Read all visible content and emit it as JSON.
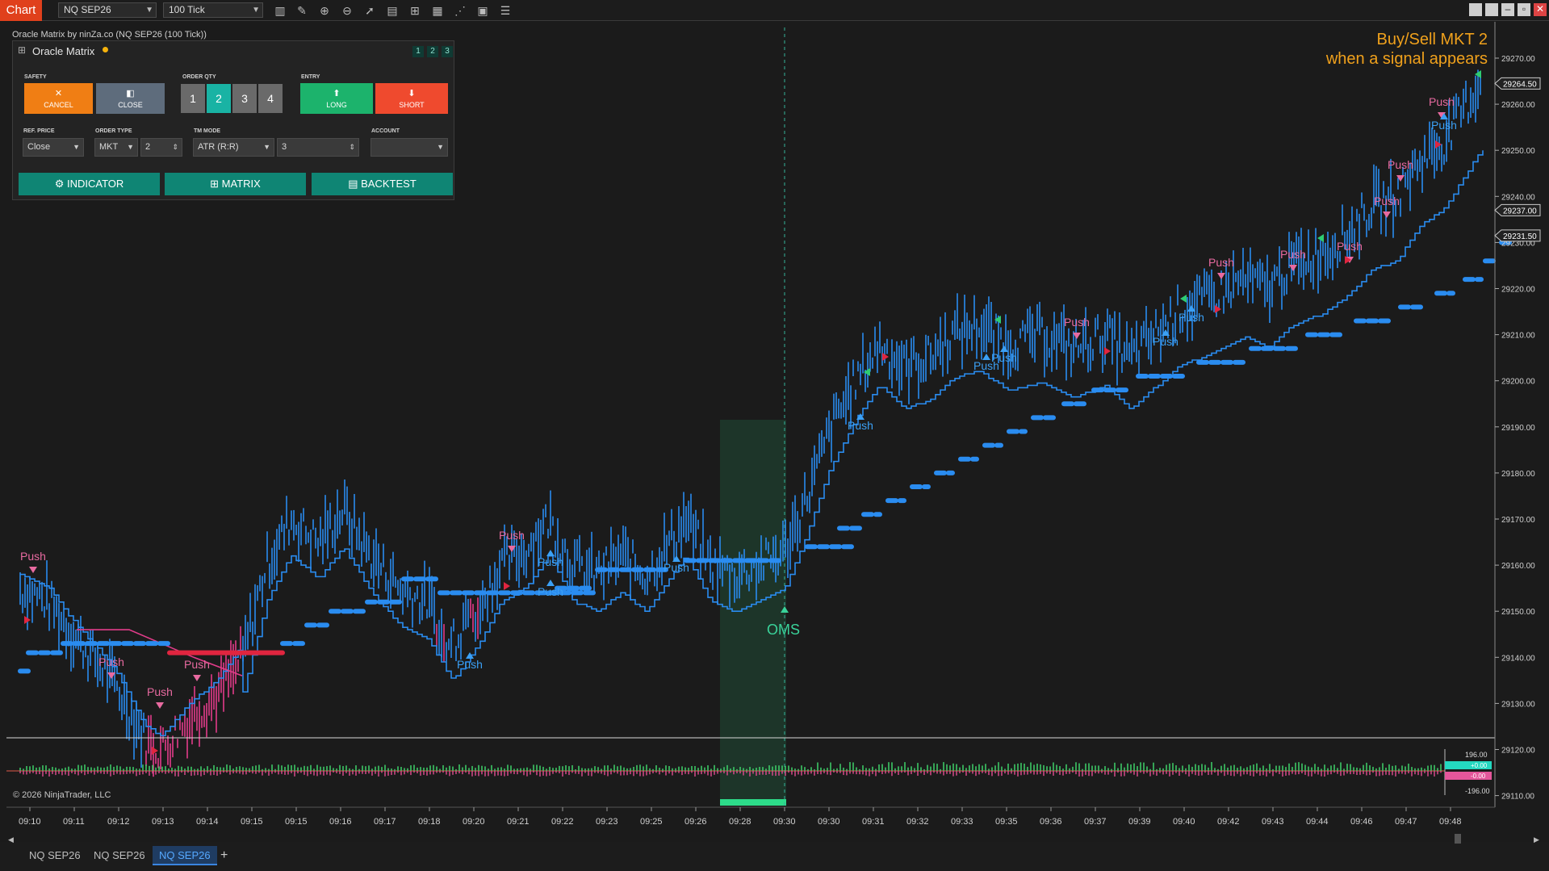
{
  "toolbar": {
    "chart_tab": "Chart",
    "instrument": "NQ SEP26",
    "interval": "100 Tick",
    "icons": [
      "bar-type-icon",
      "draw-pencil-icon",
      "zoom-in-icon",
      "zoom-out-icon",
      "pointer-icon",
      "data-box-icon",
      "chart-trader-icon",
      "templates-icon",
      "strategies-icon",
      "properties-icon",
      "object-list-icon"
    ],
    "window_buttons": [
      "restore-icon",
      "minimize-icon",
      "maximize-icon",
      "close-icon"
    ]
  },
  "indicator_label": "Oracle Matrix by ninZa.co (NQ SEP26 (100 Tick))",
  "panel": {
    "title": "Oracle Matrix",
    "pages": [
      "1",
      "2",
      "3"
    ],
    "sections": {
      "safety": "SAFETY",
      "order_qty": "ORDER QTY",
      "entry": "ENTRY",
      "ref_price": "REF. PRICE",
      "order_type": "ORDER TYPE",
      "tm_mode": "TM MODE",
      "account": "ACCOUNT"
    },
    "cancel": "CANCEL",
    "close": "CLOSE",
    "qty": [
      "1",
      "2",
      "3",
      "4"
    ],
    "qty_selected": "2",
    "long": "LONG",
    "short": "SHORT",
    "ref_price_value": "Close",
    "order_type_value": "MKT",
    "order_type_qty": "2",
    "tm_mode_value": "ATR (R:R)",
    "tm_mode_qty": "3",
    "account_value": "",
    "indicator_btn": "INDICATOR",
    "matrix_btn": "MATRIX",
    "backtest_btn": "BACKTEST"
  },
  "overlay_note": {
    "line1": "Buy/Sell MKT 2",
    "line2": "when a signal appears"
  },
  "price_axis": {
    "labels": [
      "29270.00",
      "29260.00",
      "29250.00",
      "29240.00",
      "29230.00",
      "29220.00",
      "29210.00",
      "29200.00",
      "29190.00",
      "29180.00",
      "29170.00",
      "29160.00",
      "29150.00",
      "29140.00",
      "29130.00",
      "29120.00",
      "29110.00"
    ],
    "tags": [
      "29264.50",
      "29237.00",
      "29231.50"
    ]
  },
  "time_axis": [
    "09:10",
    "09:11",
    "09:12",
    "09:13",
    "09:14",
    "09:15",
    "09:15",
    "09:16",
    "09:17",
    "09:18",
    "09:20",
    "09:21",
    "09:22",
    "09:23",
    "09:25",
    "09:26",
    "09:28",
    "09:30",
    "09:30",
    "09:31",
    "09:32",
    "09:33",
    "09:35",
    "09:36",
    "09:37",
    "09:39",
    "09:40",
    "09:42",
    "09:43",
    "09:44",
    "09:46",
    "09:47",
    "09:48"
  ],
  "signals": {
    "push": "Push",
    "oms": "OMS"
  },
  "sub_panel": {
    "upper": "196.00",
    "lower": "-196.00",
    "tag_up": "+0.00",
    "tag_down": "-0.00"
  },
  "copyright": "© 2026 NinjaTrader, LLC",
  "bottom_tabs": [
    "NQ SEP26",
    "NQ SEP26",
    "NQ SEP26"
  ],
  "active_tab_index": 2,
  "colors": {
    "accent": "#e0401c",
    "bull": "#2a8cf0",
    "bear": "#e23c8a",
    "teal": "#0f8574",
    "push_label": "#e86aa0",
    "push_label_blue": "#3ba0f5"
  }
}
